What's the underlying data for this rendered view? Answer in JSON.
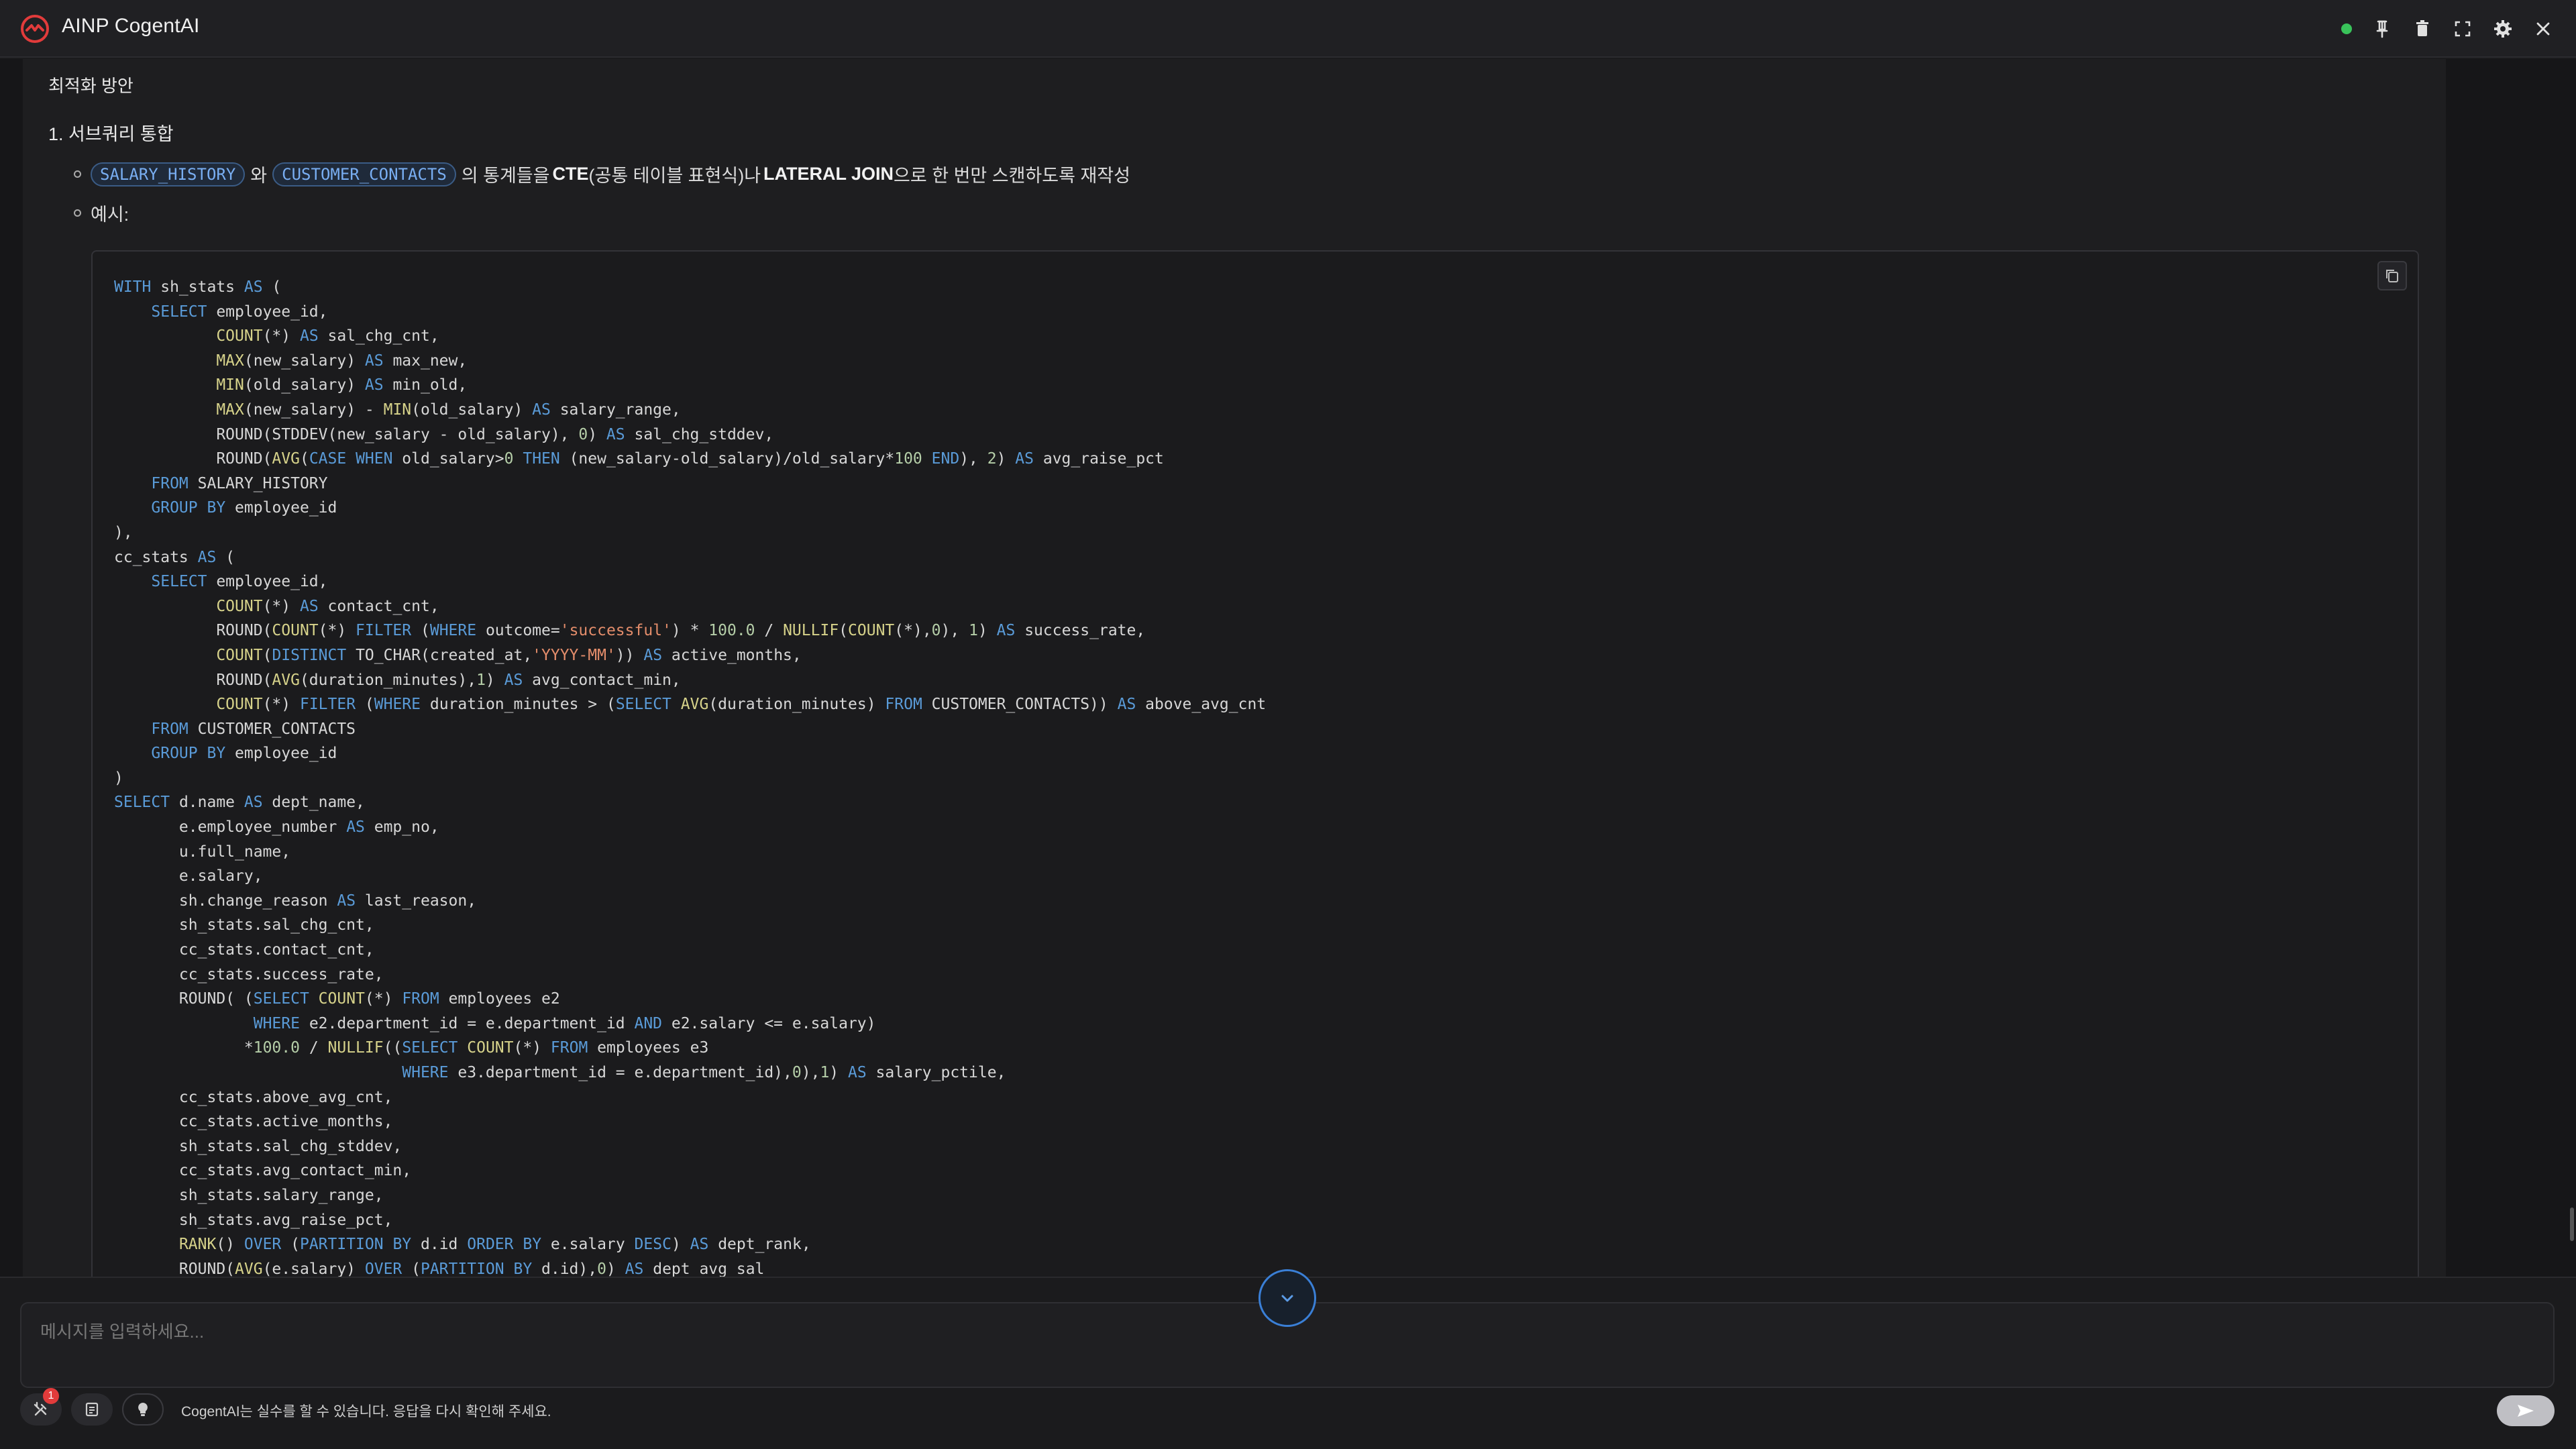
{
  "app": {
    "title": "AINP CogentAI",
    "accent_color": "#e23b3b"
  },
  "toolbar": {
    "icons": [
      "status-dot",
      "pin-icon",
      "trash-icon",
      "expand-icon",
      "gear-icon",
      "close-icon"
    ]
  },
  "content": {
    "section_title": "최적화 방안",
    "subsection_title": "1. 서브쿼리 통합",
    "bullet1": {
      "chip1": "SALARY_HISTORY",
      "connector": "와",
      "chip2": "CUSTOMER_CONTACTS",
      "text_a": "의 통계들을",
      "strong_a": "CTE",
      "text_b": "(공통 테이블 표현식)나",
      "strong_b": "LATERAL JOIN",
      "text_c": "으로 한 번만 스캔하도록 재작성"
    },
    "bullet2": "예시:"
  },
  "code_lines": [
    "WITH sh_stats AS (",
    "    SELECT employee_id,",
    "           COUNT(*) AS sal_chg_cnt,",
    "           MAX(new_salary) AS max_new,",
    "           MIN(old_salary) AS min_old,",
    "           MAX(new_salary) - MIN(old_salary) AS salary_range,",
    "           ROUND(STDDEV(new_salary - old_salary), 0) AS sal_chg_stddev,",
    "           ROUND(AVG(CASE WHEN old_salary>0 THEN (new_salary-old_salary)/old_salary*100 END), 2) AS avg_raise_pct",
    "    FROM SALARY_HISTORY",
    "    GROUP BY employee_id",
    "),",
    "cc_stats AS (",
    "    SELECT employee_id,",
    "           COUNT(*) AS contact_cnt,",
    "           ROUND(COUNT(*) FILTER (WHERE outcome='successful') * 100.0 / NULLIF(COUNT(*),0), 1) AS success_rate,",
    "           COUNT(DISTINCT TO_CHAR(created_at,'YYYY-MM')) AS active_months,",
    "           ROUND(AVG(duration_minutes),1) AS avg_contact_min,",
    "           COUNT(*) FILTER (WHERE duration_minutes > (SELECT AVG(duration_minutes) FROM CUSTOMER_CONTACTS)) AS above_avg_cnt",
    "    FROM CUSTOMER_CONTACTS",
    "    GROUP BY employee_id",
    ")",
    "SELECT d.name AS dept_name,",
    "       e.employee_number AS emp_no,",
    "       u.full_name,",
    "       e.salary,",
    "       sh.change_reason AS last_reason,",
    "       sh_stats.sal_chg_cnt,",
    "       cc_stats.contact_cnt,",
    "       cc_stats.success_rate,",
    "       ROUND( (SELECT COUNT(*) FROM employees e2",
    "               WHERE e2.department_id = e.department_id AND e2.salary <= e.salary)",
    "              *100.0 / NULLIF((SELECT COUNT(*) FROM employees e3",
    "                               WHERE e3.department_id = e.department_id),0),1) AS salary_pctile,",
    "       cc_stats.above_avg_cnt,",
    "       cc_stats.active_months,",
    "       sh_stats.sal_chg_stddev,",
    "       cc_stats.avg_contact_min,",
    "       sh_stats.salary_range,",
    "       sh_stats.avg_raise_pct,",
    "       RANK() OVER (PARTITION BY d.id ORDER BY e.salary DESC) AS dept_rank,",
    "       ROUND(AVG(e.salary) OVER (PARTITION BY d.id),0) AS dept_avg_sal"
  ],
  "composer": {
    "placeholder": "메시지를 입력하세요...",
    "tools_badge": "1",
    "disclaimer": "CogentAI는 실수를 할 수 있습니다. 응답을 다시 확인해 주세요."
  }
}
